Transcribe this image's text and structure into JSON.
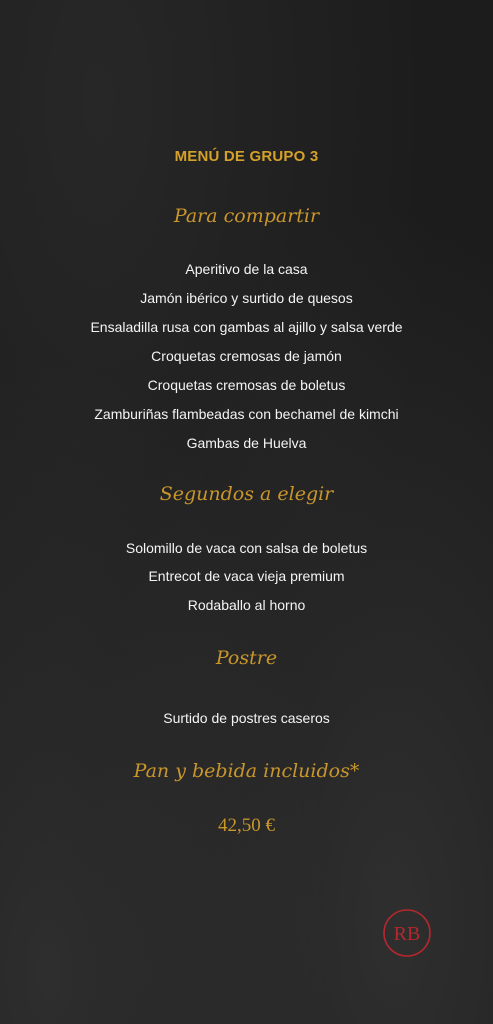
{
  "menu": {
    "title": "MENÚ DE GRUPO 3",
    "sections": [
      {
        "heading": "Para compartir",
        "items": [
          "Aperitivo de la casa",
          "Jamón ibérico y surtido de quesos",
          "Ensaladilla rusa con gambas al ajillo y salsa verde",
          "Croquetas cremosas de jamón",
          "Croquetas cremosas de boletus",
          "Zamburiñas flambeadas con bechamel de kimchi",
          "Gambas de Huelva"
        ]
      },
      {
        "heading": "Segundos a elegir",
        "items": [
          "Solomillo de vaca con salsa de boletus",
          "Entrecot de vaca vieja premium",
          "Rodaballo al horno"
        ]
      },
      {
        "heading": "Postre",
        "items": [
          "Surtido de postres caseros"
        ]
      },
      {
        "heading": "Pan y bebida incluidos*",
        "items": []
      }
    ],
    "price": "42,50 €",
    "logo_text": "RB"
  },
  "colors": {
    "accent_gold": "#c9962b",
    "title_gold": "#d4a12a",
    "logo_red": "#b3282d",
    "background": "#1c1c1c"
  }
}
